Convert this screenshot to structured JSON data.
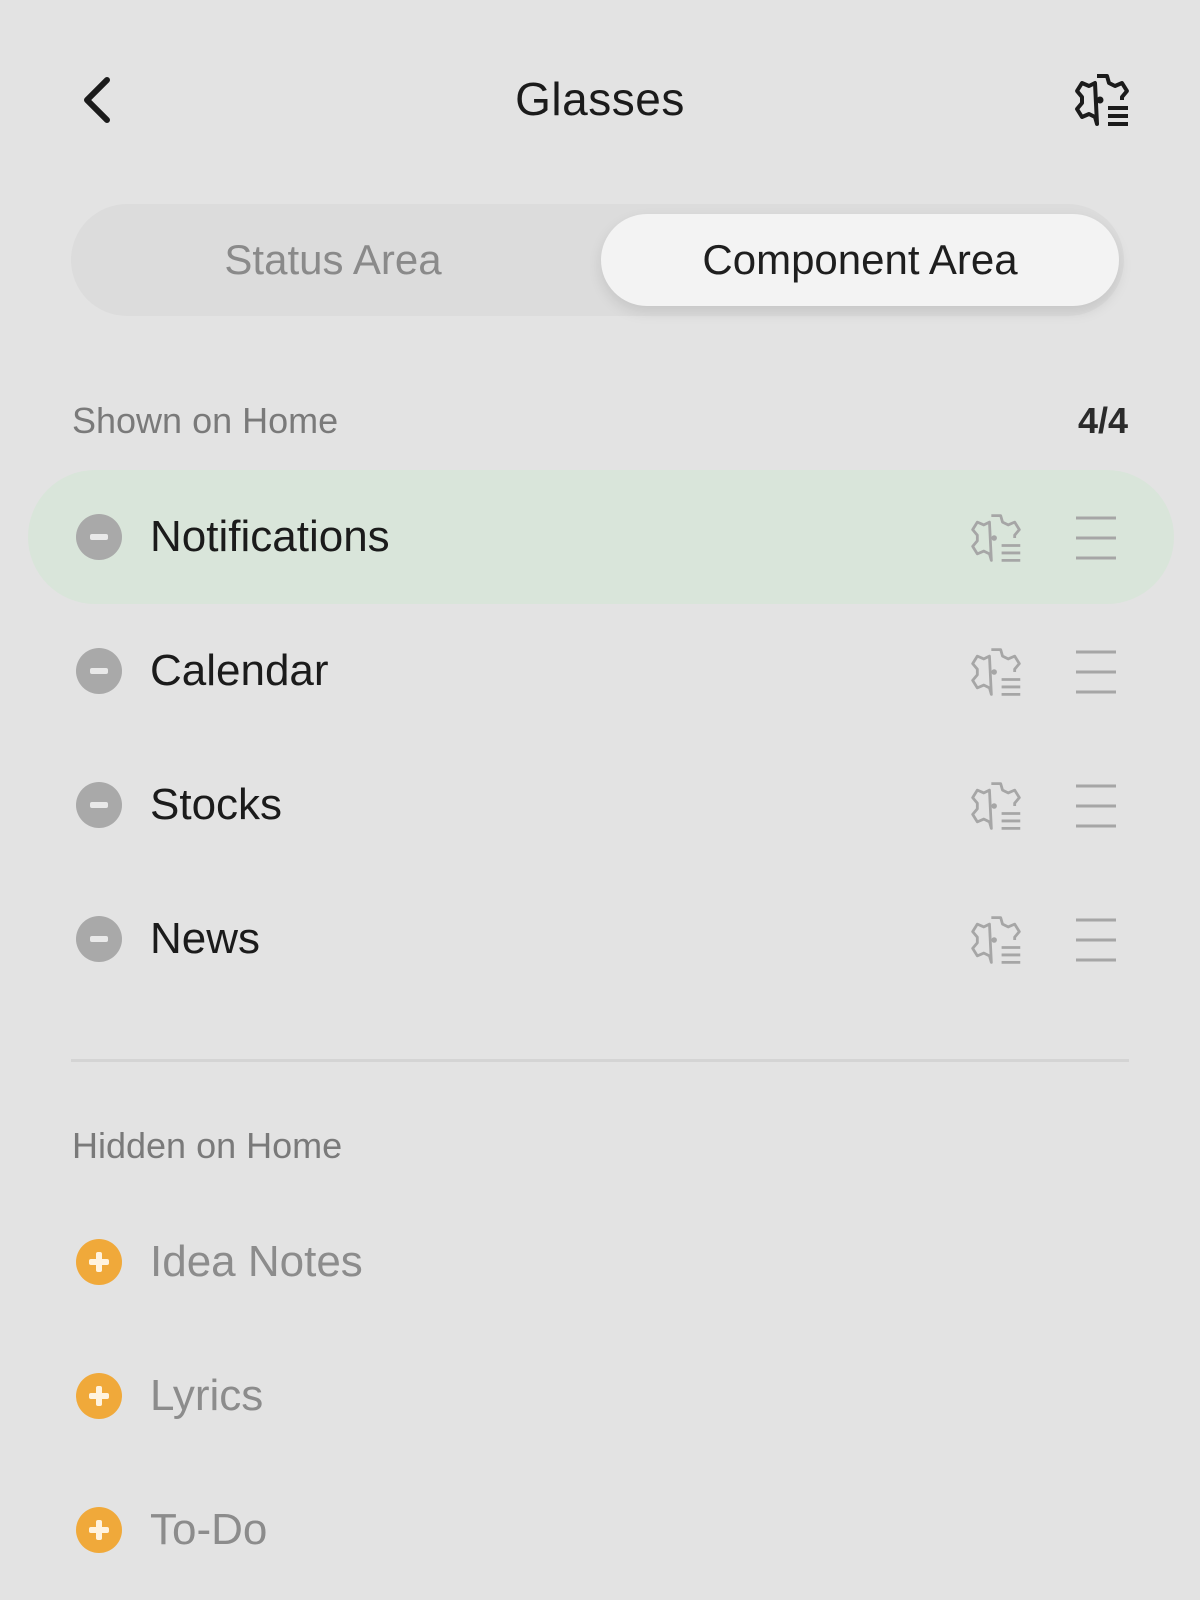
{
  "header": {
    "title": "Glasses",
    "back_icon": "chevron-left-icon",
    "settings_icon": "gear-list-icon"
  },
  "tabs": [
    {
      "label": "Status Area",
      "selected": false
    },
    {
      "label": "Component Area",
      "selected": true
    }
  ],
  "shown": {
    "label": "Shown on Home",
    "count": "4/4",
    "items": [
      {
        "label": "Notifications",
        "highlighted": true
      },
      {
        "label": "Calendar"
      },
      {
        "label": "Stocks"
      },
      {
        "label": "News"
      }
    ]
  },
  "hidden": {
    "label": "Hidden on Home",
    "items": [
      {
        "label": "Idea Notes"
      },
      {
        "label": "Lyrics"
      },
      {
        "label": "To-Do"
      }
    ]
  },
  "colors": {
    "background": "#e3e3e3",
    "highlight": "#d9e5da",
    "add": "#f0a93a",
    "remove": "#a9a9a9"
  }
}
